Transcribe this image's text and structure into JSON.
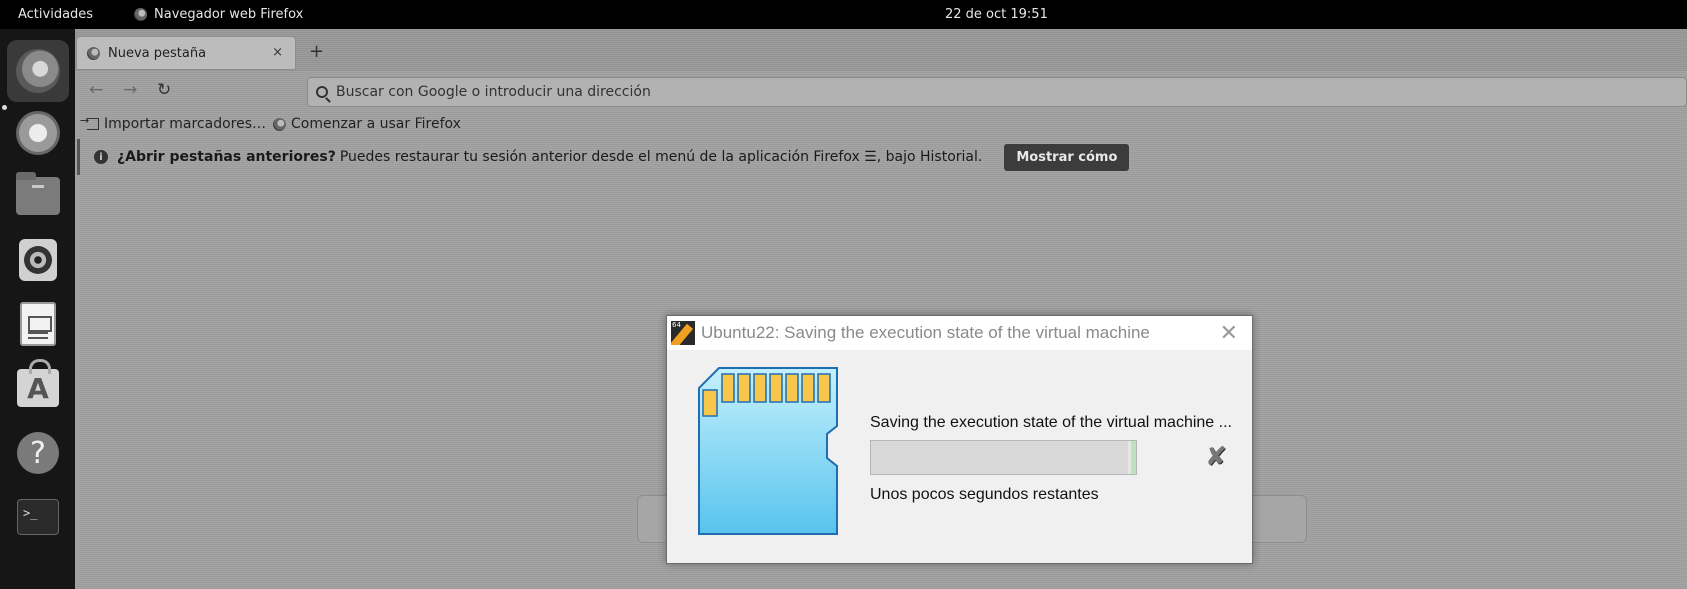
{
  "topbar": {
    "activities": "Actividades",
    "app_name": "Navegador web Firefox",
    "clock": "22 de oct  19:51"
  },
  "dock": {
    "items": [
      "firefox-icon",
      "mail-icon",
      "files-icon",
      "speaker-icon",
      "document-viewer-icon",
      "software-store-icon",
      "help-icon",
      "terminal-icon"
    ],
    "help_glyph": "?",
    "terminal_glyph": ">_",
    "store_glyph": "A"
  },
  "browser": {
    "tab_title": "Nueva pestaña",
    "tab_close": "×",
    "new_tab": "+",
    "back": "←",
    "forward": "→",
    "reload": "↻",
    "url_placeholder": "Buscar con Google o introducir una dirección",
    "bookmarks": [
      "Importar marcadores…",
      "Comenzar a usar Firefox"
    ],
    "notice_bold": "¿Abrir pestañas anteriores?",
    "notice_text": "Puedes restaurar tu sesión anterior desde el menú de la aplicación Firefox ☰, bajo Historial.",
    "notice_button": "Mostrar cómo",
    "info_glyph": "i"
  },
  "dialog": {
    "title": "Ubuntu22: Saving the execution state of the virtual machine",
    "close": "✕",
    "message": "Saving the execution state of the virtual machine ...",
    "progress_fraction": 0.97,
    "status": "Unos pocos segundos restantes",
    "cancel_glyph": "✘"
  },
  "colors": {
    "sd_card_body": "#7fd4f5",
    "sd_card_contacts": "#f7c64a",
    "notice_button_bg": "#3c3c3c"
  }
}
